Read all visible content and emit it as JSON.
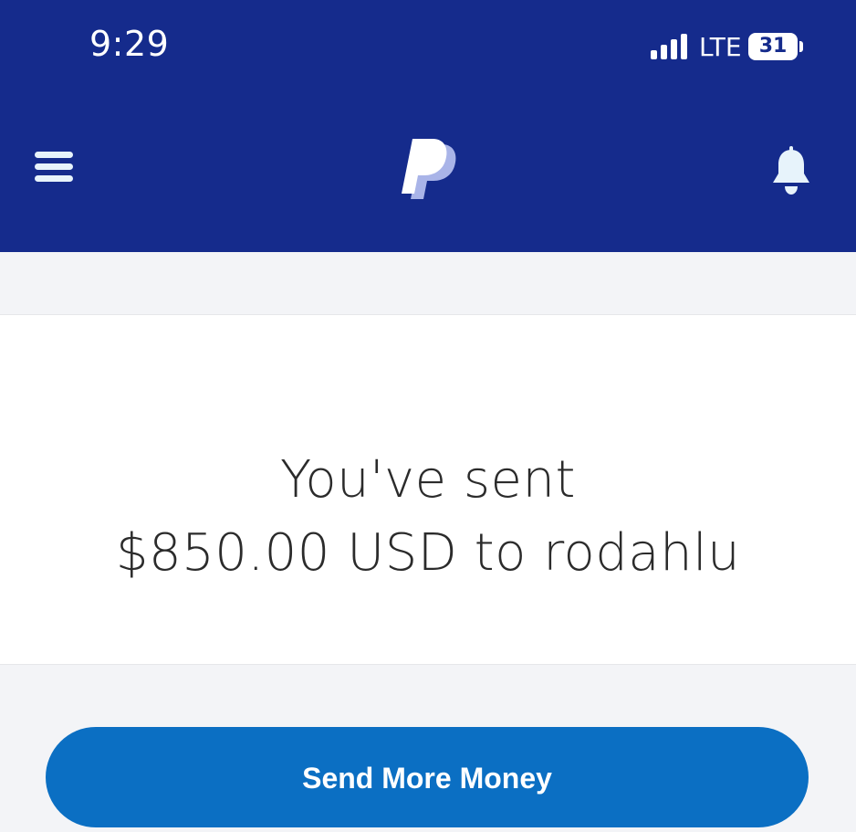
{
  "status_bar": {
    "time": "9:29",
    "network": "LTE",
    "battery": "31"
  },
  "app_bar": {
    "menu_icon": "hamburger-menu-icon",
    "logo_icon": "paypal-logo",
    "bell_icon": "notification-bell-icon"
  },
  "confirmation": {
    "line1": "You've sent",
    "line2": "$850.00 USD to rodahlu"
  },
  "actions": {
    "send_more_label": "Send More Money"
  },
  "colors": {
    "header_bg": "#152b8c",
    "page_bg": "#f3f4f7",
    "button_bg": "#0b6fc3"
  }
}
